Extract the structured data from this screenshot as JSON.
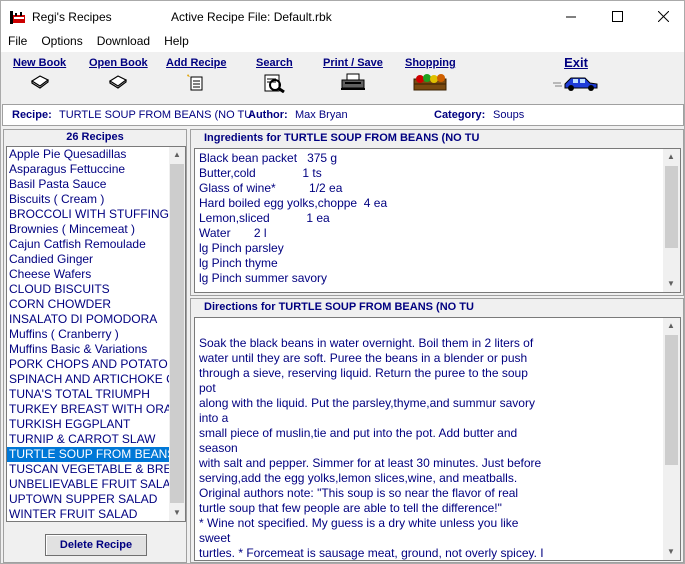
{
  "window": {
    "app_title": "Regi's Recipes",
    "active_file": "Active Recipe File:  Default.rbk"
  },
  "menu": [
    "File",
    "Options",
    "Download",
    "Help"
  ],
  "toolbar": {
    "new_book": "New Book",
    "open_book": "Open Book",
    "add_recipe": "Add Recipe",
    "search": "Search",
    "print_save": "Print / Save",
    "shopping": "Shopping",
    "exit": "Exit"
  },
  "info": {
    "recipe_label": "Recipe:",
    "recipe_value": "TURTLE SOUP FROM BEANS (NO TU",
    "author_label": "Author:",
    "author_value": "Max Bryan",
    "category_label": "Category:",
    "category_value": "Soups"
  },
  "recipes": {
    "count_label": "26 Recipes",
    "items": [
      "Apple Pie Quesadillas",
      "Asparagus Fettuccine",
      "Basil Pasta Sauce",
      "Biscuits ( Cream )",
      "BROCCOLI WITH STUFFING",
      "Brownies ( Mincemeat )",
      "Cajun Catfish Remoulade",
      "Candied Ginger",
      "Cheese Wafers",
      "CLOUD BISCUITS",
      "CORN CHOWDER",
      "INSALATO DI POMODORA",
      "Muffins ( Cranberry )",
      "Muffins Basic & Variations",
      "PORK CHOPS AND POTATO",
      "SPINACH AND ARTICHOKE C",
      "TUNA'S TOTAL TRIUMPH",
      "TURKEY BREAST WITH ORA",
      "TURKISH EGGPLANT",
      "TURNIP & CARROT SLAW",
      "TURTLE SOUP FROM BEANS",
      "TUSCAN VEGETABLE & BRE",
      "UNBELIEVABLE FRUIT SALA",
      "UPTOWN SUPPER SALAD",
      "WINTER FRUIT SALAD"
    ],
    "selected_index": 20,
    "delete_label": "Delete Recipe"
  },
  "ingredients": {
    "header": "Ingredients for TURTLE SOUP FROM BEANS (NO TU",
    "lines": [
      "Black bean packet   375 g",
      "Butter,cold              1 ts",
      "Glass of wine*          1/2 ea",
      "Hard boiled egg yolks,choppe  4 ea",
      "Lemon,sliced           1 ea",
      "Water       2 l",
      "lg Pinch parsley",
      "lg Pinch thyme",
      "lg Pinch summer savory"
    ]
  },
  "directions": {
    "header": "Directions for TURTLE SOUP FROM BEANS (NO TU",
    "lines": [
      "Soak the black beans in water overnight. Boil them in 2 liters of",
      "water until they are soft. Puree the beans in a blender or push",
      "through a sieve, reserving liquid. Return the puree to the soup",
      "pot",
      "along with the liquid. Put the parsley,thyme,and summur savory",
      "into a",
      "small piece of muslin,tie and put into the pot. Add butter and",
      "season",
      "with salt and pepper. Simmer for at least 30 minutes. Just before",
      "serving,add the egg yolks,lemon slices,wine, and meatballs.",
      "Original authors note: \"This soup is so near the flavor of real",
      "turtle soup that few people are able to tell the difference!\"",
      "* Wine not specified. My guess is a dry white unless you like",
      "sweet",
      "turtles. * Forcemeat is sausage meat, ground, not overly spicey. I"
    ]
  },
  "colors": {
    "accent_text": "#000080",
    "selection": "#0078d7"
  }
}
